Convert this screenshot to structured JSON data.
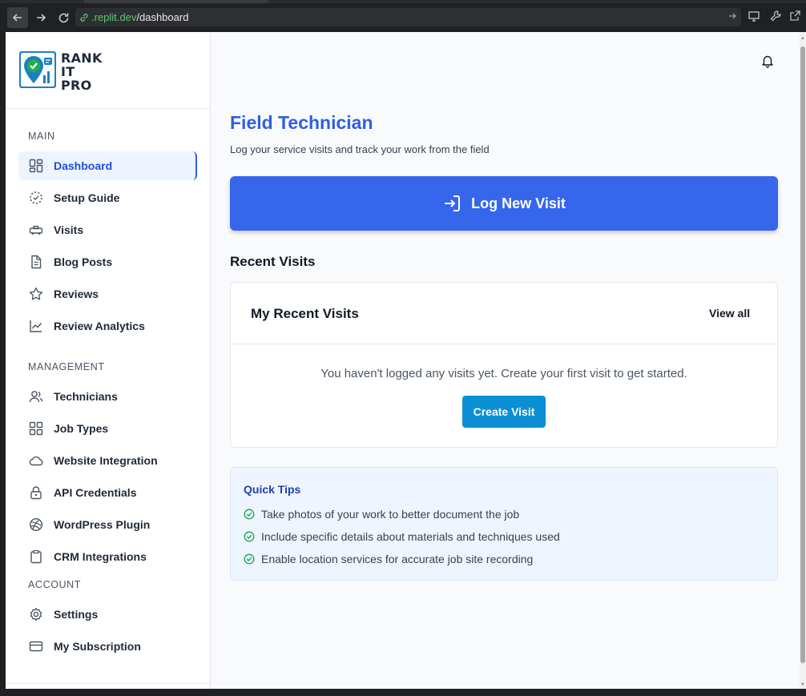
{
  "browser": {
    "url_host": ".replit.dev",
    "url_path": "/dashboard"
  },
  "brand": {
    "line1": "RANK",
    "line2": "IT",
    "line3": "PRO",
    "colors": {
      "primary": "#2f5ee0",
      "button": "#3666ec",
      "secondary_button": "#0b8fd4",
      "success": "#16a34a"
    }
  },
  "sidebar": {
    "sections": [
      {
        "title": "MAIN"
      },
      {
        "title": "MANAGEMENT"
      },
      {
        "title": "ACCOUNT"
      }
    ],
    "items": [
      {
        "label": "Dashboard",
        "icon": "dashboard-grid-icon",
        "active": true
      },
      {
        "label": "Setup Guide",
        "icon": "dashed-circle-icon"
      },
      {
        "label": "Visits",
        "icon": "truck-icon"
      },
      {
        "label": "Blog Posts",
        "icon": "document-icon"
      },
      {
        "label": "Reviews",
        "icon": "star-icon"
      },
      {
        "label": "Review Analytics",
        "icon": "line-chart-icon"
      },
      {
        "label": "Technicians",
        "icon": "users-icon"
      },
      {
        "label": "Job Types",
        "icon": "grid-icon"
      },
      {
        "label": "Website Integration",
        "icon": "cloud-icon"
      },
      {
        "label": "API Credentials",
        "icon": "lock-icon"
      },
      {
        "label": "WordPress Plugin",
        "icon": "globe-icon"
      },
      {
        "label": "CRM Integrations",
        "icon": "clipboard-icon"
      },
      {
        "label": "Settings",
        "icon": "gear-icon"
      },
      {
        "label": "My Subscription",
        "icon": "credit-card-icon"
      }
    ]
  },
  "main": {
    "title": "Field Technician",
    "subtitle": "Log your service visits and track your work from the field",
    "log_button": "Log New Visit",
    "recent_heading": "Recent Visits",
    "card": {
      "title": "My Recent Visits",
      "view_all": "View all",
      "empty_message": "You haven't logged any visits yet. Create your first visit to get started.",
      "create_button": "Create Visit"
    },
    "tips": {
      "title": "Quick Tips",
      "items": [
        "Take photos of your work to better document the job",
        "Include specific details about materials and techniques used",
        "Enable location services for accurate job site recording"
      ]
    }
  }
}
